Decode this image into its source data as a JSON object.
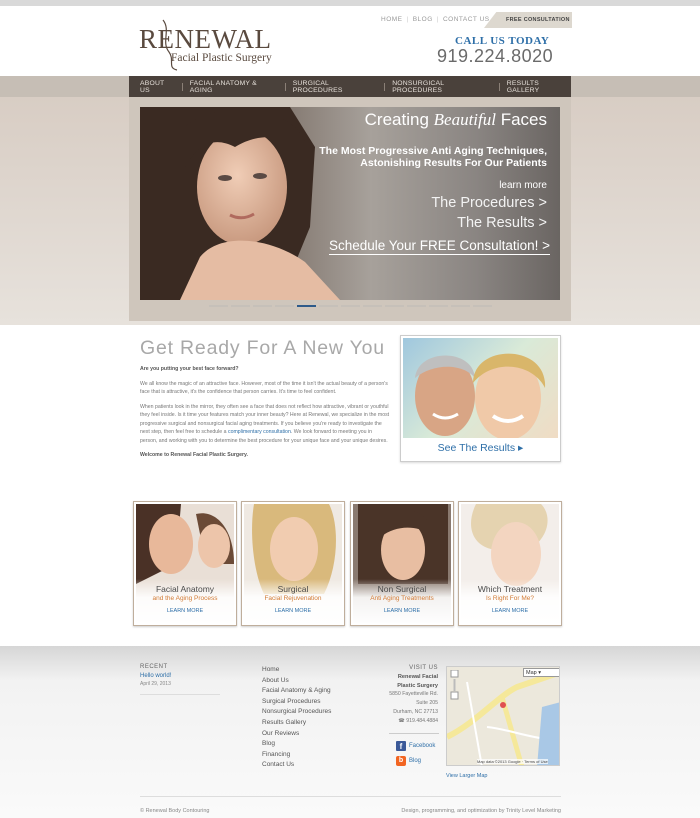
{
  "brand": {
    "name": "RENEWAL",
    "tagline": "Facial Plastic Surgery"
  },
  "utility_nav": [
    "HOME",
    "BLOG",
    "CONTACT US"
  ],
  "free_consultation_tab": "FREE CONSULTATION",
  "contact": {
    "call_label": "CALL US TODAY",
    "phone": "919.224.8020"
  },
  "main_nav": [
    "ABOUT US",
    "FACIAL ANATOMY & AGING",
    "SURGICAL PROCEDURES",
    "NONSURGICAL PROCEDURES",
    "RESULTS GALLERY"
  ],
  "hero": {
    "title_pre": "Creating ",
    "title_em": "Beautiful",
    "title_post": " Faces",
    "tagline_1": "The Most Progressive Anti Aging Techniques,",
    "tagline_2": "Astonishing Results For Our Patients",
    "learn_more": "learn more",
    "link_procedures": "The Procedures >",
    "link_results": "The Results >",
    "schedule": "Schedule Your FREE Consultation! >",
    "slide_count": 13,
    "active_slide": 5
  },
  "intro": {
    "title": "Get Ready For A New You",
    "lead": "Are you putting your best face forward?",
    "para1": "We all know the magic of an attractive face. However, most of the time it isn't the actual beauty of a person's face that is attractive, it's the confidence that person carries. It's time to feel confident.",
    "para2_a": "When patients look in the mirror, they often see a face that does not reflect how attractive, vibrant or youthful they feel inside. Is it time your features match your inner beauty? Here at Renewal, we specialize in the most progressive surgical and nonsurgical facial aging treatments. If you believe you're ready to investigate the next step, then feel free to schedule a ",
    "para2_link": "complimentary consultation",
    "para2_b": ". We look forward to meeting you in person, and working with you to determine the best procedure for your unique face and your unique desires.",
    "closing": "Welcome to Renewal Facial Plastic Surgery."
  },
  "results_box": {
    "label": "See The Results"
  },
  "cards": [
    {
      "title": "Facial Anatomy",
      "subtitle": "and the Aging Process",
      "cta": "LEARN MORE"
    },
    {
      "title": "Surgical",
      "subtitle": "Facial Rejuvenation",
      "cta": "LEARN MORE"
    },
    {
      "title": "Non Surgical",
      "subtitle": "Anti Aging Treatments",
      "cta": "LEARN MORE"
    },
    {
      "title": "Which Treatment",
      "subtitle": "Is Right For Me?",
      "cta": "LEARN MORE"
    }
  ],
  "footer": {
    "recent_heading": "RECENT",
    "recent_post": "Hello world!",
    "recent_date": "April 29, 2013",
    "links": [
      "Home",
      "About Us",
      "Facial Anatomy & Aging",
      "Surgical Procedures",
      "Nonsurgical Procedures",
      "Results Gallery",
      "Our Reviews",
      "Blog",
      "Financing",
      "Contact Us"
    ],
    "visit_heading": "VISIT US",
    "visit_name_1": "Renewal Facial",
    "visit_name_2": "Plastic Surgery",
    "address_1": "5850 Fayetteville Rd.",
    "address_2": "Suite 205",
    "address_3": "Durham, NC 27713",
    "phone": "☎ 919.484.4884",
    "social_facebook": "Facebook",
    "social_blog": "Blog",
    "map_type": "Map",
    "map_credit": "Map data ©2013 Google · Terms of Use",
    "map_larger": "View Larger Map",
    "copyright": "© Renewal Body Contouring",
    "credit": "Design, programming, and optimization by Trinity Level Marketing"
  },
  "colors": {
    "accent_blue": "#2e6fa8",
    "nav_bg": "#4a413b",
    "card_subtitle": "#d27b35"
  }
}
